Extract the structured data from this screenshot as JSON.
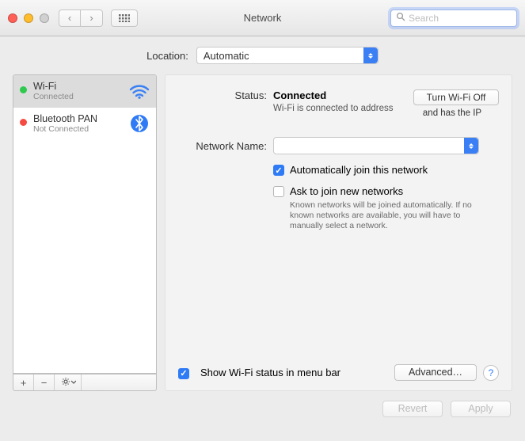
{
  "window": {
    "title": "Network"
  },
  "search": {
    "placeholder": "Search",
    "value": ""
  },
  "location": {
    "label": "Location:",
    "value": "Automatic"
  },
  "sidebar": {
    "items": [
      {
        "name": "Wi-Fi",
        "status": "Connected",
        "dot": "green",
        "icon": "wifi",
        "selected": true
      },
      {
        "name": "Bluetooth PAN",
        "status": "Not Connected",
        "dot": "red",
        "icon": "bluetooth",
        "selected": false
      }
    ],
    "tools": {
      "add": "+",
      "remove": "−",
      "gear": "✻▾"
    }
  },
  "detail": {
    "status_label": "Status:",
    "status_value": "Connected",
    "status_sub": "Wi-Fi is connected to address",
    "wifi_toggle": "Turn Wi-Fi Off",
    "ip_hint": "and has the IP",
    "netname_label": "Network Name:",
    "netname_value": "",
    "auto_join": {
      "checked": true,
      "label": "Automatically join this network"
    },
    "ask_join": {
      "checked": false,
      "label": "Ask to join new networks"
    },
    "ask_help": "Known networks will be joined automatically. If no known networks are available, you will have to manually select a network.",
    "show_menu": {
      "checked": true,
      "label": "Show Wi-Fi status in menu bar"
    },
    "advanced": "Advanced…",
    "help": "?"
  },
  "footer": {
    "revert": "Revert",
    "apply": "Apply"
  }
}
